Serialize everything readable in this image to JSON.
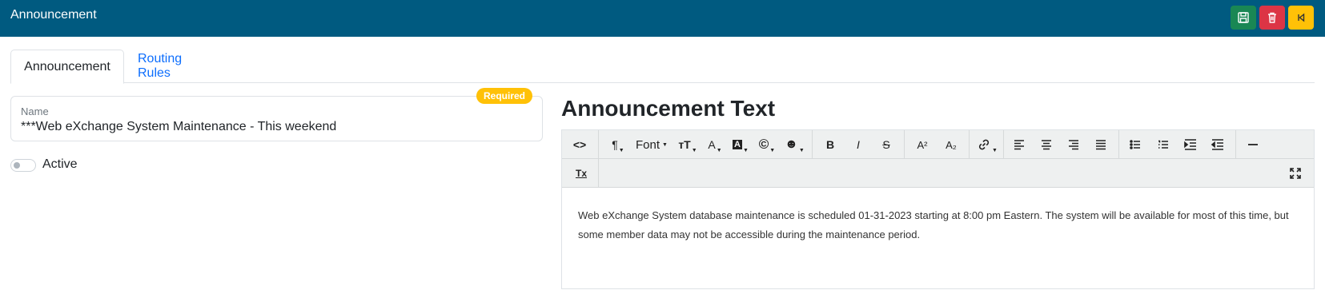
{
  "header": {
    "title": "Announcement",
    "save_icon": "save-icon",
    "delete_icon": "trash-icon",
    "back_icon": "skip-back-icon",
    "colors": {
      "bar": "#005a80",
      "save": "#198754",
      "delete": "#dc3545",
      "back": "#ffc107"
    }
  },
  "tabs": [
    {
      "label": "Announcement",
      "active": true
    },
    {
      "label": "Routing Rules",
      "active": false
    }
  ],
  "form": {
    "name_label": "Name",
    "name_value": "***Web eXchange System Maintenance - This weekend",
    "required_badge": "Required",
    "active_label": "Active",
    "active_on": false
  },
  "editor": {
    "title": "Announcement Text",
    "toolbar": {
      "code_view": "<>",
      "paragraph": "¶",
      "font": "Font",
      "font_size": "тT",
      "text_color": "A",
      "bg_color": "A",
      "special_chars": "©",
      "emoji": "☻",
      "bold": "B",
      "italic": "I",
      "strike": "S",
      "superscript": "A²",
      "subscript": "A₂",
      "clear_format": "Tx"
    },
    "content": "Web eXchange System database maintenance is scheduled 01-31-2023 starting at 8:00 pm Eastern.  The system will be available for most of this time, but some member data may not be accessible during the maintenance period."
  }
}
